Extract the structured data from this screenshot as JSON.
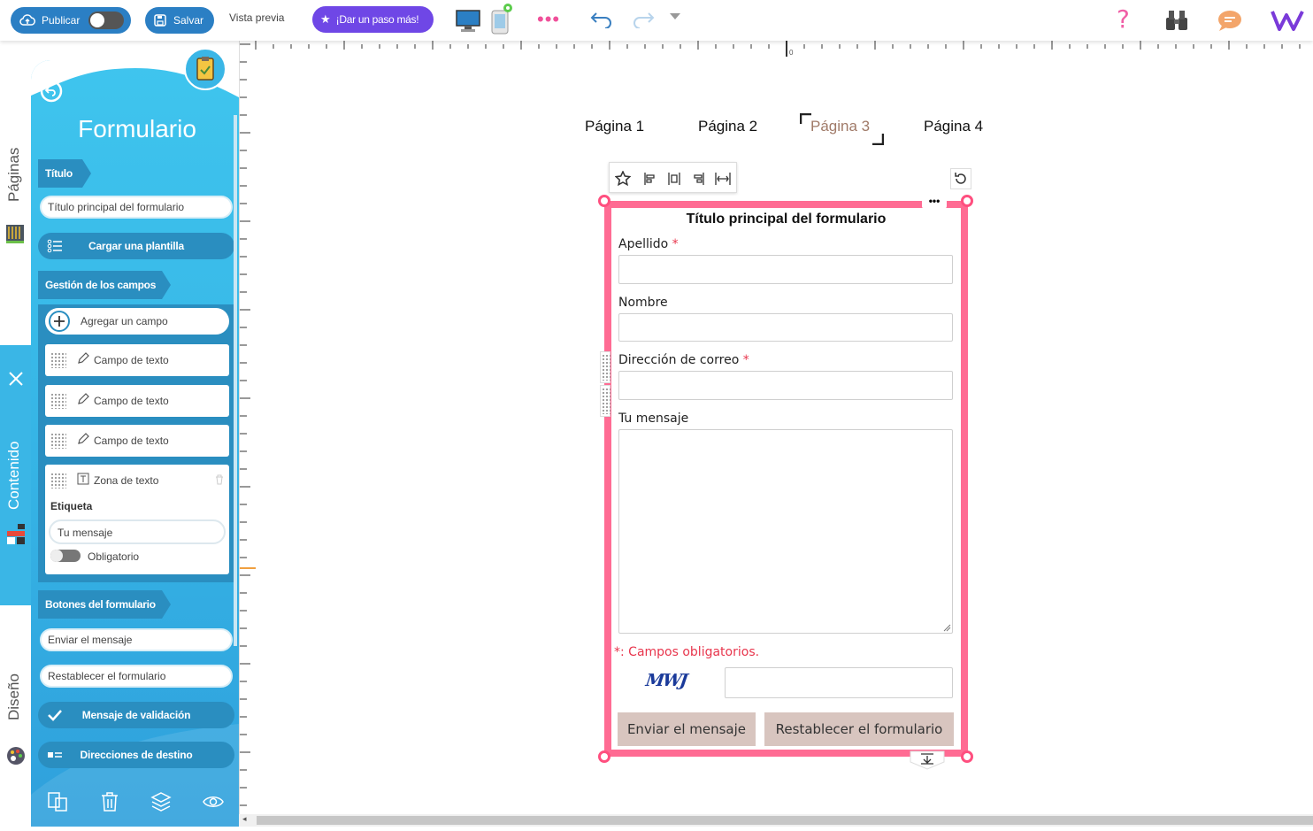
{
  "topbar": {
    "publish_label": "Publicar",
    "save_label": "Salvar",
    "preview_label": "Vista previa",
    "upgrade_label": "¡Dar un paso más!"
  },
  "rail": {
    "pages_label": "Páginas",
    "content_label": "Contenido",
    "design_label": "Diseño"
  },
  "panel": {
    "title": "Formulario",
    "title_section": "Título",
    "title_input": "Título principal del formulario",
    "load_template": "Cargar una plantilla",
    "fields_section": "Gestión de los campos",
    "add_field": "Agregar un campo",
    "fields": [
      {
        "label": "Campo de texto",
        "icon": "pencil-icon"
      },
      {
        "label": "Campo de texto",
        "icon": "pencil-icon"
      },
      {
        "label": "Campo de texto",
        "icon": "pencil-icon"
      }
    ],
    "textarea_field": {
      "label": "Zona de texto",
      "etiqueta_label": "Etiqueta",
      "etiqueta_value": "Tu mensaje",
      "required_label": "Obligatorio"
    },
    "buttons_section": "Botones del formulario",
    "send_button_input": "Enviar el mensaje",
    "reset_button_input": "Restablecer el formulario",
    "validation_message": "Mensaje de validación",
    "destination_addresses": "Direcciones de destino"
  },
  "ruler": {
    "zero": "0"
  },
  "pages": [
    "Página 1",
    "Página 2",
    "Página 3",
    "Página 4"
  ],
  "active_page_index": 2,
  "colors": {
    "accent_blue": "#2b7fc4",
    "upgrade_purple": "#6f47e6",
    "panel_blue": "#35b3e5",
    "frame_pink": "#ff6b93",
    "button_beige": "#d8c5bf",
    "active_page": "#a07a68"
  },
  "form": {
    "title": "Título principal del formulario",
    "fields": {
      "apellido": "Apellido",
      "nombre": "Nombre",
      "correo": "Dirección de correo",
      "mensaje": "Tu mensaje"
    },
    "required_marker": "*",
    "required_note": "*: Campos obligatorios.",
    "captcha_text": "MWJ",
    "send_button": "Enviar el mensaje",
    "reset_button": "Restablecer el formulario"
  }
}
